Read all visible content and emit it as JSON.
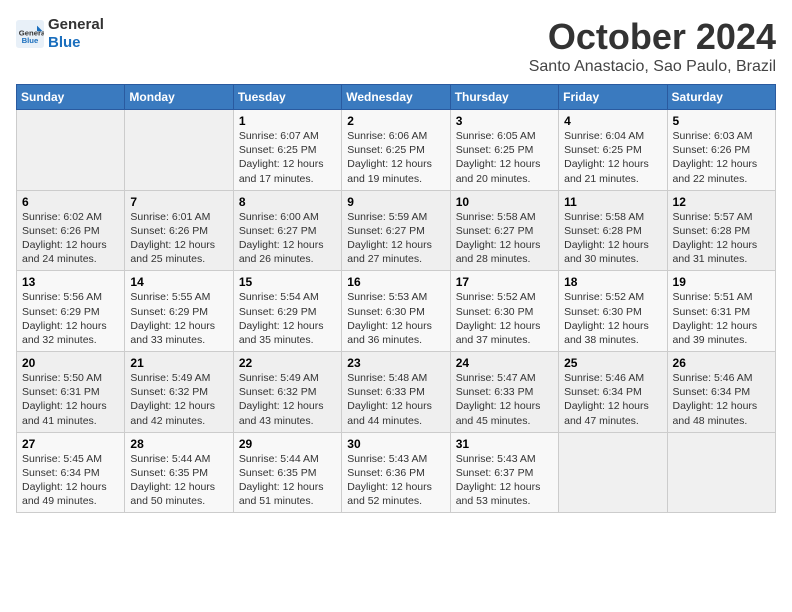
{
  "header": {
    "logo_line1": "General",
    "logo_line2": "Blue",
    "title": "October 2024",
    "subtitle": "Santo Anastacio, Sao Paulo, Brazil"
  },
  "calendar": {
    "weekdays": [
      "Sunday",
      "Monday",
      "Tuesday",
      "Wednesday",
      "Thursday",
      "Friday",
      "Saturday"
    ],
    "weeks": [
      [
        {
          "day": "",
          "sunrise": "",
          "sunset": "",
          "daylight": ""
        },
        {
          "day": "",
          "sunrise": "",
          "sunset": "",
          "daylight": ""
        },
        {
          "day": "1",
          "sunrise": "Sunrise: 6:07 AM",
          "sunset": "Sunset: 6:25 PM",
          "daylight": "Daylight: 12 hours and 17 minutes."
        },
        {
          "day": "2",
          "sunrise": "Sunrise: 6:06 AM",
          "sunset": "Sunset: 6:25 PM",
          "daylight": "Daylight: 12 hours and 19 minutes."
        },
        {
          "day": "3",
          "sunrise": "Sunrise: 6:05 AM",
          "sunset": "Sunset: 6:25 PM",
          "daylight": "Daylight: 12 hours and 20 minutes."
        },
        {
          "day": "4",
          "sunrise": "Sunrise: 6:04 AM",
          "sunset": "Sunset: 6:25 PM",
          "daylight": "Daylight: 12 hours and 21 minutes."
        },
        {
          "day": "5",
          "sunrise": "Sunrise: 6:03 AM",
          "sunset": "Sunset: 6:26 PM",
          "daylight": "Daylight: 12 hours and 22 minutes."
        }
      ],
      [
        {
          "day": "6",
          "sunrise": "Sunrise: 6:02 AM",
          "sunset": "Sunset: 6:26 PM",
          "daylight": "Daylight: 12 hours and 24 minutes."
        },
        {
          "day": "7",
          "sunrise": "Sunrise: 6:01 AM",
          "sunset": "Sunset: 6:26 PM",
          "daylight": "Daylight: 12 hours and 25 minutes."
        },
        {
          "day": "8",
          "sunrise": "Sunrise: 6:00 AM",
          "sunset": "Sunset: 6:27 PM",
          "daylight": "Daylight: 12 hours and 26 minutes."
        },
        {
          "day": "9",
          "sunrise": "Sunrise: 5:59 AM",
          "sunset": "Sunset: 6:27 PM",
          "daylight": "Daylight: 12 hours and 27 minutes."
        },
        {
          "day": "10",
          "sunrise": "Sunrise: 5:58 AM",
          "sunset": "Sunset: 6:27 PM",
          "daylight": "Daylight: 12 hours and 28 minutes."
        },
        {
          "day": "11",
          "sunrise": "Sunrise: 5:58 AM",
          "sunset": "Sunset: 6:28 PM",
          "daylight": "Daylight: 12 hours and 30 minutes."
        },
        {
          "day": "12",
          "sunrise": "Sunrise: 5:57 AM",
          "sunset": "Sunset: 6:28 PM",
          "daylight": "Daylight: 12 hours and 31 minutes."
        }
      ],
      [
        {
          "day": "13",
          "sunrise": "Sunrise: 5:56 AM",
          "sunset": "Sunset: 6:29 PM",
          "daylight": "Daylight: 12 hours and 32 minutes."
        },
        {
          "day": "14",
          "sunrise": "Sunrise: 5:55 AM",
          "sunset": "Sunset: 6:29 PM",
          "daylight": "Daylight: 12 hours and 33 minutes."
        },
        {
          "day": "15",
          "sunrise": "Sunrise: 5:54 AM",
          "sunset": "Sunset: 6:29 PM",
          "daylight": "Daylight: 12 hours and 35 minutes."
        },
        {
          "day": "16",
          "sunrise": "Sunrise: 5:53 AM",
          "sunset": "Sunset: 6:30 PM",
          "daylight": "Daylight: 12 hours and 36 minutes."
        },
        {
          "day": "17",
          "sunrise": "Sunrise: 5:52 AM",
          "sunset": "Sunset: 6:30 PM",
          "daylight": "Daylight: 12 hours and 37 minutes."
        },
        {
          "day": "18",
          "sunrise": "Sunrise: 5:52 AM",
          "sunset": "Sunset: 6:30 PM",
          "daylight": "Daylight: 12 hours and 38 minutes."
        },
        {
          "day": "19",
          "sunrise": "Sunrise: 5:51 AM",
          "sunset": "Sunset: 6:31 PM",
          "daylight": "Daylight: 12 hours and 39 minutes."
        }
      ],
      [
        {
          "day": "20",
          "sunrise": "Sunrise: 5:50 AM",
          "sunset": "Sunset: 6:31 PM",
          "daylight": "Daylight: 12 hours and 41 minutes."
        },
        {
          "day": "21",
          "sunrise": "Sunrise: 5:49 AM",
          "sunset": "Sunset: 6:32 PM",
          "daylight": "Daylight: 12 hours and 42 minutes."
        },
        {
          "day": "22",
          "sunrise": "Sunrise: 5:49 AM",
          "sunset": "Sunset: 6:32 PM",
          "daylight": "Daylight: 12 hours and 43 minutes."
        },
        {
          "day": "23",
          "sunrise": "Sunrise: 5:48 AM",
          "sunset": "Sunset: 6:33 PM",
          "daylight": "Daylight: 12 hours and 44 minutes."
        },
        {
          "day": "24",
          "sunrise": "Sunrise: 5:47 AM",
          "sunset": "Sunset: 6:33 PM",
          "daylight": "Daylight: 12 hours and 45 minutes."
        },
        {
          "day": "25",
          "sunrise": "Sunrise: 5:46 AM",
          "sunset": "Sunset: 6:34 PM",
          "daylight": "Daylight: 12 hours and 47 minutes."
        },
        {
          "day": "26",
          "sunrise": "Sunrise: 5:46 AM",
          "sunset": "Sunset: 6:34 PM",
          "daylight": "Daylight: 12 hours and 48 minutes."
        }
      ],
      [
        {
          "day": "27",
          "sunrise": "Sunrise: 5:45 AM",
          "sunset": "Sunset: 6:34 PM",
          "daylight": "Daylight: 12 hours and 49 minutes."
        },
        {
          "day": "28",
          "sunrise": "Sunrise: 5:44 AM",
          "sunset": "Sunset: 6:35 PM",
          "daylight": "Daylight: 12 hours and 50 minutes."
        },
        {
          "day": "29",
          "sunrise": "Sunrise: 5:44 AM",
          "sunset": "Sunset: 6:35 PM",
          "daylight": "Daylight: 12 hours and 51 minutes."
        },
        {
          "day": "30",
          "sunrise": "Sunrise: 5:43 AM",
          "sunset": "Sunset: 6:36 PM",
          "daylight": "Daylight: 12 hours and 52 minutes."
        },
        {
          "day": "31",
          "sunrise": "Sunrise: 5:43 AM",
          "sunset": "Sunset: 6:37 PM",
          "daylight": "Daylight: 12 hours and 53 minutes."
        },
        {
          "day": "",
          "sunrise": "",
          "sunset": "",
          "daylight": ""
        },
        {
          "day": "",
          "sunrise": "",
          "sunset": "",
          "daylight": ""
        }
      ]
    ]
  }
}
